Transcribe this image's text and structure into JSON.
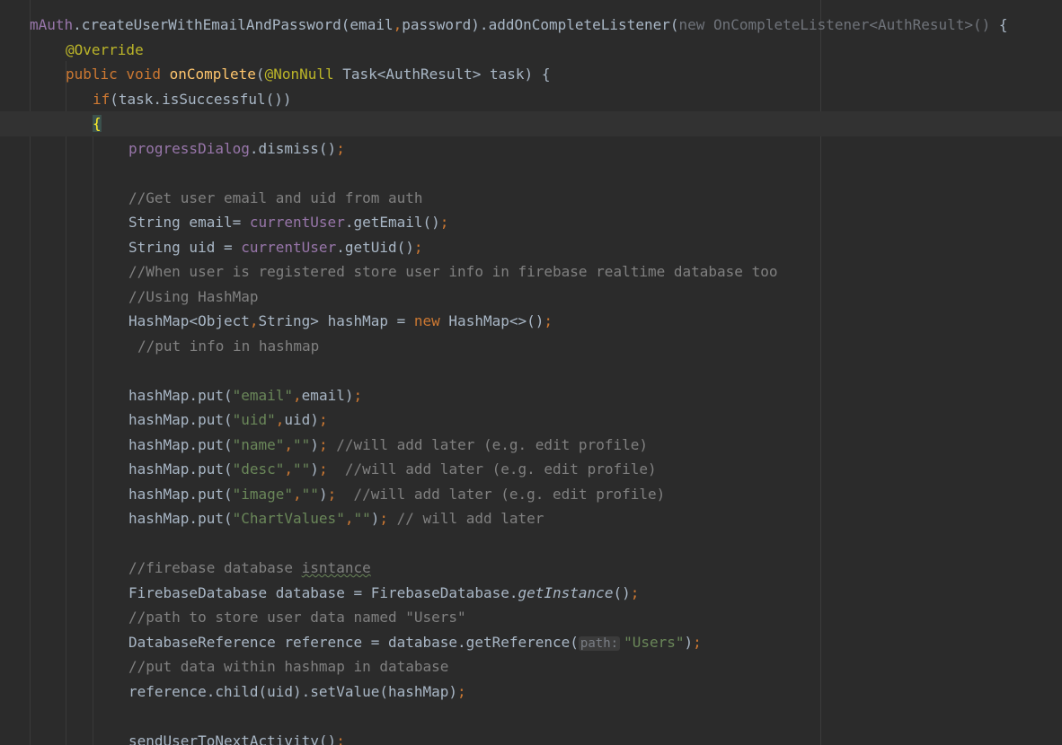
{
  "theme": {
    "background": "#2b2b2b",
    "default": "#a9b7c6",
    "field": "#9876aa",
    "keyword": "#cc7832",
    "annotation": "#bbb529",
    "method_decl": "#ffc66d",
    "string": "#6a8759",
    "comment": "#808080",
    "dim": "#6f737a",
    "current_line": "#323232"
  },
  "code_lines": [
    {
      "indent": 33,
      "tokens": [
        {
          "t": "mAuth",
          "c": "field"
        },
        {
          "t": ".createUserWithEmailAndPassword(email",
          "c": "default"
        },
        {
          "t": ",",
          "c": "keyword"
        },
        {
          "t": "password).addOnCompleteListener(",
          "c": "default"
        },
        {
          "t": "new OnCompleteListener<AuthResult>()",
          "c": "dim"
        },
        {
          "t": " {",
          "c": "default"
        }
      ]
    },
    {
      "indent": 73,
      "tokens": [
        {
          "t": "@Override",
          "c": "annotation"
        }
      ]
    },
    {
      "indent": 73,
      "tokens": [
        {
          "t": "public void ",
          "c": "keyword"
        },
        {
          "t": "onComplete",
          "c": "method_decl"
        },
        {
          "t": "(",
          "c": "default"
        },
        {
          "t": "@NonNull",
          "c": "annotation"
        },
        {
          "t": " Task<AuthResult> task) {",
          "c": "default"
        }
      ]
    },
    {
      "indent": 103,
      "tokens": [
        {
          "t": "if",
          "c": "keyword"
        },
        {
          "t": "(task.isSuccessful())",
          "c": "default"
        }
      ]
    },
    {
      "indent": 103,
      "current": true,
      "tokens": [
        {
          "t": "{",
          "c": "brace"
        }
      ]
    },
    {
      "indent": 143,
      "tokens": [
        {
          "t": "progressDialog",
          "c": "field"
        },
        {
          "t": ".dismiss()",
          "c": "default"
        },
        {
          "t": ";",
          "c": "keyword"
        }
      ]
    },
    {
      "indent": 143,
      "tokens": []
    },
    {
      "indent": 143,
      "tokens": [
        {
          "t": "//Get user email and uid from auth",
          "c": "comment"
        }
      ]
    },
    {
      "indent": 143,
      "tokens": [
        {
          "t": "String email= ",
          "c": "default"
        },
        {
          "t": "currentUser",
          "c": "field"
        },
        {
          "t": ".getEmail()",
          "c": "default"
        },
        {
          "t": ";",
          "c": "keyword"
        }
      ]
    },
    {
      "indent": 143,
      "tokens": [
        {
          "t": "String uid = ",
          "c": "default"
        },
        {
          "t": "currentUser",
          "c": "field"
        },
        {
          "t": ".getUid()",
          "c": "default"
        },
        {
          "t": ";",
          "c": "keyword"
        }
      ]
    },
    {
      "indent": 143,
      "tokens": [
        {
          "t": "//When user is registered store user info in firebase realtime database too",
          "c": "comment"
        }
      ]
    },
    {
      "indent": 143,
      "tokens": [
        {
          "t": "//Using HashMap",
          "c": "comment"
        }
      ]
    },
    {
      "indent": 143,
      "tokens": [
        {
          "t": "HashMap<Object",
          "c": "default"
        },
        {
          "t": ",",
          "c": "keyword"
        },
        {
          "t": "String> hashMap = ",
          "c": "default"
        },
        {
          "t": "new ",
          "c": "keyword"
        },
        {
          "t": "HashMap<>()",
          "c": "default"
        },
        {
          "t": ";",
          "c": "keyword"
        }
      ]
    },
    {
      "indent": 153,
      "tokens": [
        {
          "t": "//put info in hashmap",
          "c": "comment"
        }
      ]
    },
    {
      "indent": 143,
      "tokens": []
    },
    {
      "indent": 143,
      "tokens": [
        {
          "t": "hashMap.put(",
          "c": "default"
        },
        {
          "t": "\"email\"",
          "c": "string"
        },
        {
          "t": ",",
          "c": "keyword"
        },
        {
          "t": "email)",
          "c": "default"
        },
        {
          "t": ";",
          "c": "keyword"
        }
      ]
    },
    {
      "indent": 143,
      "tokens": [
        {
          "t": "hashMap.put(",
          "c": "default"
        },
        {
          "t": "\"uid\"",
          "c": "string"
        },
        {
          "t": ",",
          "c": "keyword"
        },
        {
          "t": "uid)",
          "c": "default"
        },
        {
          "t": ";",
          "c": "keyword"
        }
      ]
    },
    {
      "indent": 143,
      "tokens": [
        {
          "t": "hashMap.put(",
          "c": "default"
        },
        {
          "t": "\"name\"",
          "c": "string"
        },
        {
          "t": ",",
          "c": "keyword"
        },
        {
          "t": "\"\"",
          "c": "string"
        },
        {
          "t": ")",
          "c": "default"
        },
        {
          "t": ";",
          "c": "keyword"
        },
        {
          "t": " //will add later (e.g. edit profile)",
          "c": "comment"
        }
      ]
    },
    {
      "indent": 143,
      "tokens": [
        {
          "t": "hashMap.put(",
          "c": "default"
        },
        {
          "t": "\"desc\"",
          "c": "string"
        },
        {
          "t": ",",
          "c": "keyword"
        },
        {
          "t": "\"\"",
          "c": "string"
        },
        {
          "t": ")",
          "c": "default"
        },
        {
          "t": ";",
          "c": "keyword"
        },
        {
          "t": "  //will add later (e.g. edit profile)",
          "c": "comment"
        }
      ]
    },
    {
      "indent": 143,
      "tokens": [
        {
          "t": "hashMap.put(",
          "c": "default"
        },
        {
          "t": "\"image\"",
          "c": "string"
        },
        {
          "t": ",",
          "c": "keyword"
        },
        {
          "t": "\"\"",
          "c": "string"
        },
        {
          "t": ")",
          "c": "default"
        },
        {
          "t": ";",
          "c": "keyword"
        },
        {
          "t": "  //will add later (e.g. edit profile)",
          "c": "comment"
        }
      ]
    },
    {
      "indent": 143,
      "tokens": [
        {
          "t": "hashMap.put(",
          "c": "default"
        },
        {
          "t": "\"ChartValues\"",
          "c": "string"
        },
        {
          "t": ",",
          "c": "keyword"
        },
        {
          "t": "\"\"",
          "c": "string"
        },
        {
          "t": ")",
          "c": "default"
        },
        {
          "t": ";",
          "c": "keyword"
        },
        {
          "t": " // will add later",
          "c": "comment"
        }
      ]
    },
    {
      "indent": 143,
      "tokens": []
    },
    {
      "indent": 143,
      "tokens": [
        {
          "t": "//firebase database ",
          "c": "comment"
        },
        {
          "t": "isntance",
          "c": "comment_typo"
        }
      ]
    },
    {
      "indent": 143,
      "tokens": [
        {
          "t": "FirebaseDatabase database = FirebaseDatabase.",
          "c": "default"
        },
        {
          "t": "getInstance",
          "c": "italic"
        },
        {
          "t": "()",
          "c": "default"
        },
        {
          "t": ";",
          "c": "keyword"
        }
      ]
    },
    {
      "indent": 143,
      "tokens": [
        {
          "t": "//path to store user data named \"Users\"",
          "c": "comment"
        }
      ]
    },
    {
      "indent": 143,
      "tokens": [
        {
          "t": "DatabaseReference reference = database.getReference(",
          "c": "default"
        },
        {
          "t": "path:",
          "c": "hint"
        },
        {
          "t": "\"Users\"",
          "c": "string"
        },
        {
          "t": ")",
          "c": "default"
        },
        {
          "t": ";",
          "c": "keyword"
        }
      ]
    },
    {
      "indent": 143,
      "tokens": [
        {
          "t": "//put data within hashmap in database",
          "c": "comment"
        }
      ]
    },
    {
      "indent": 143,
      "tokens": [
        {
          "t": "reference.child(uid).setValue(hashMap)",
          "c": "default"
        },
        {
          "t": ";",
          "c": "keyword"
        }
      ]
    },
    {
      "indent": 143,
      "tokens": []
    },
    {
      "indent": 143,
      "tokens": [
        {
          "t": "sendUserToNextActivity()",
          "c": "default"
        },
        {
          "t": ";",
          "c": "keyword"
        }
      ]
    }
  ]
}
